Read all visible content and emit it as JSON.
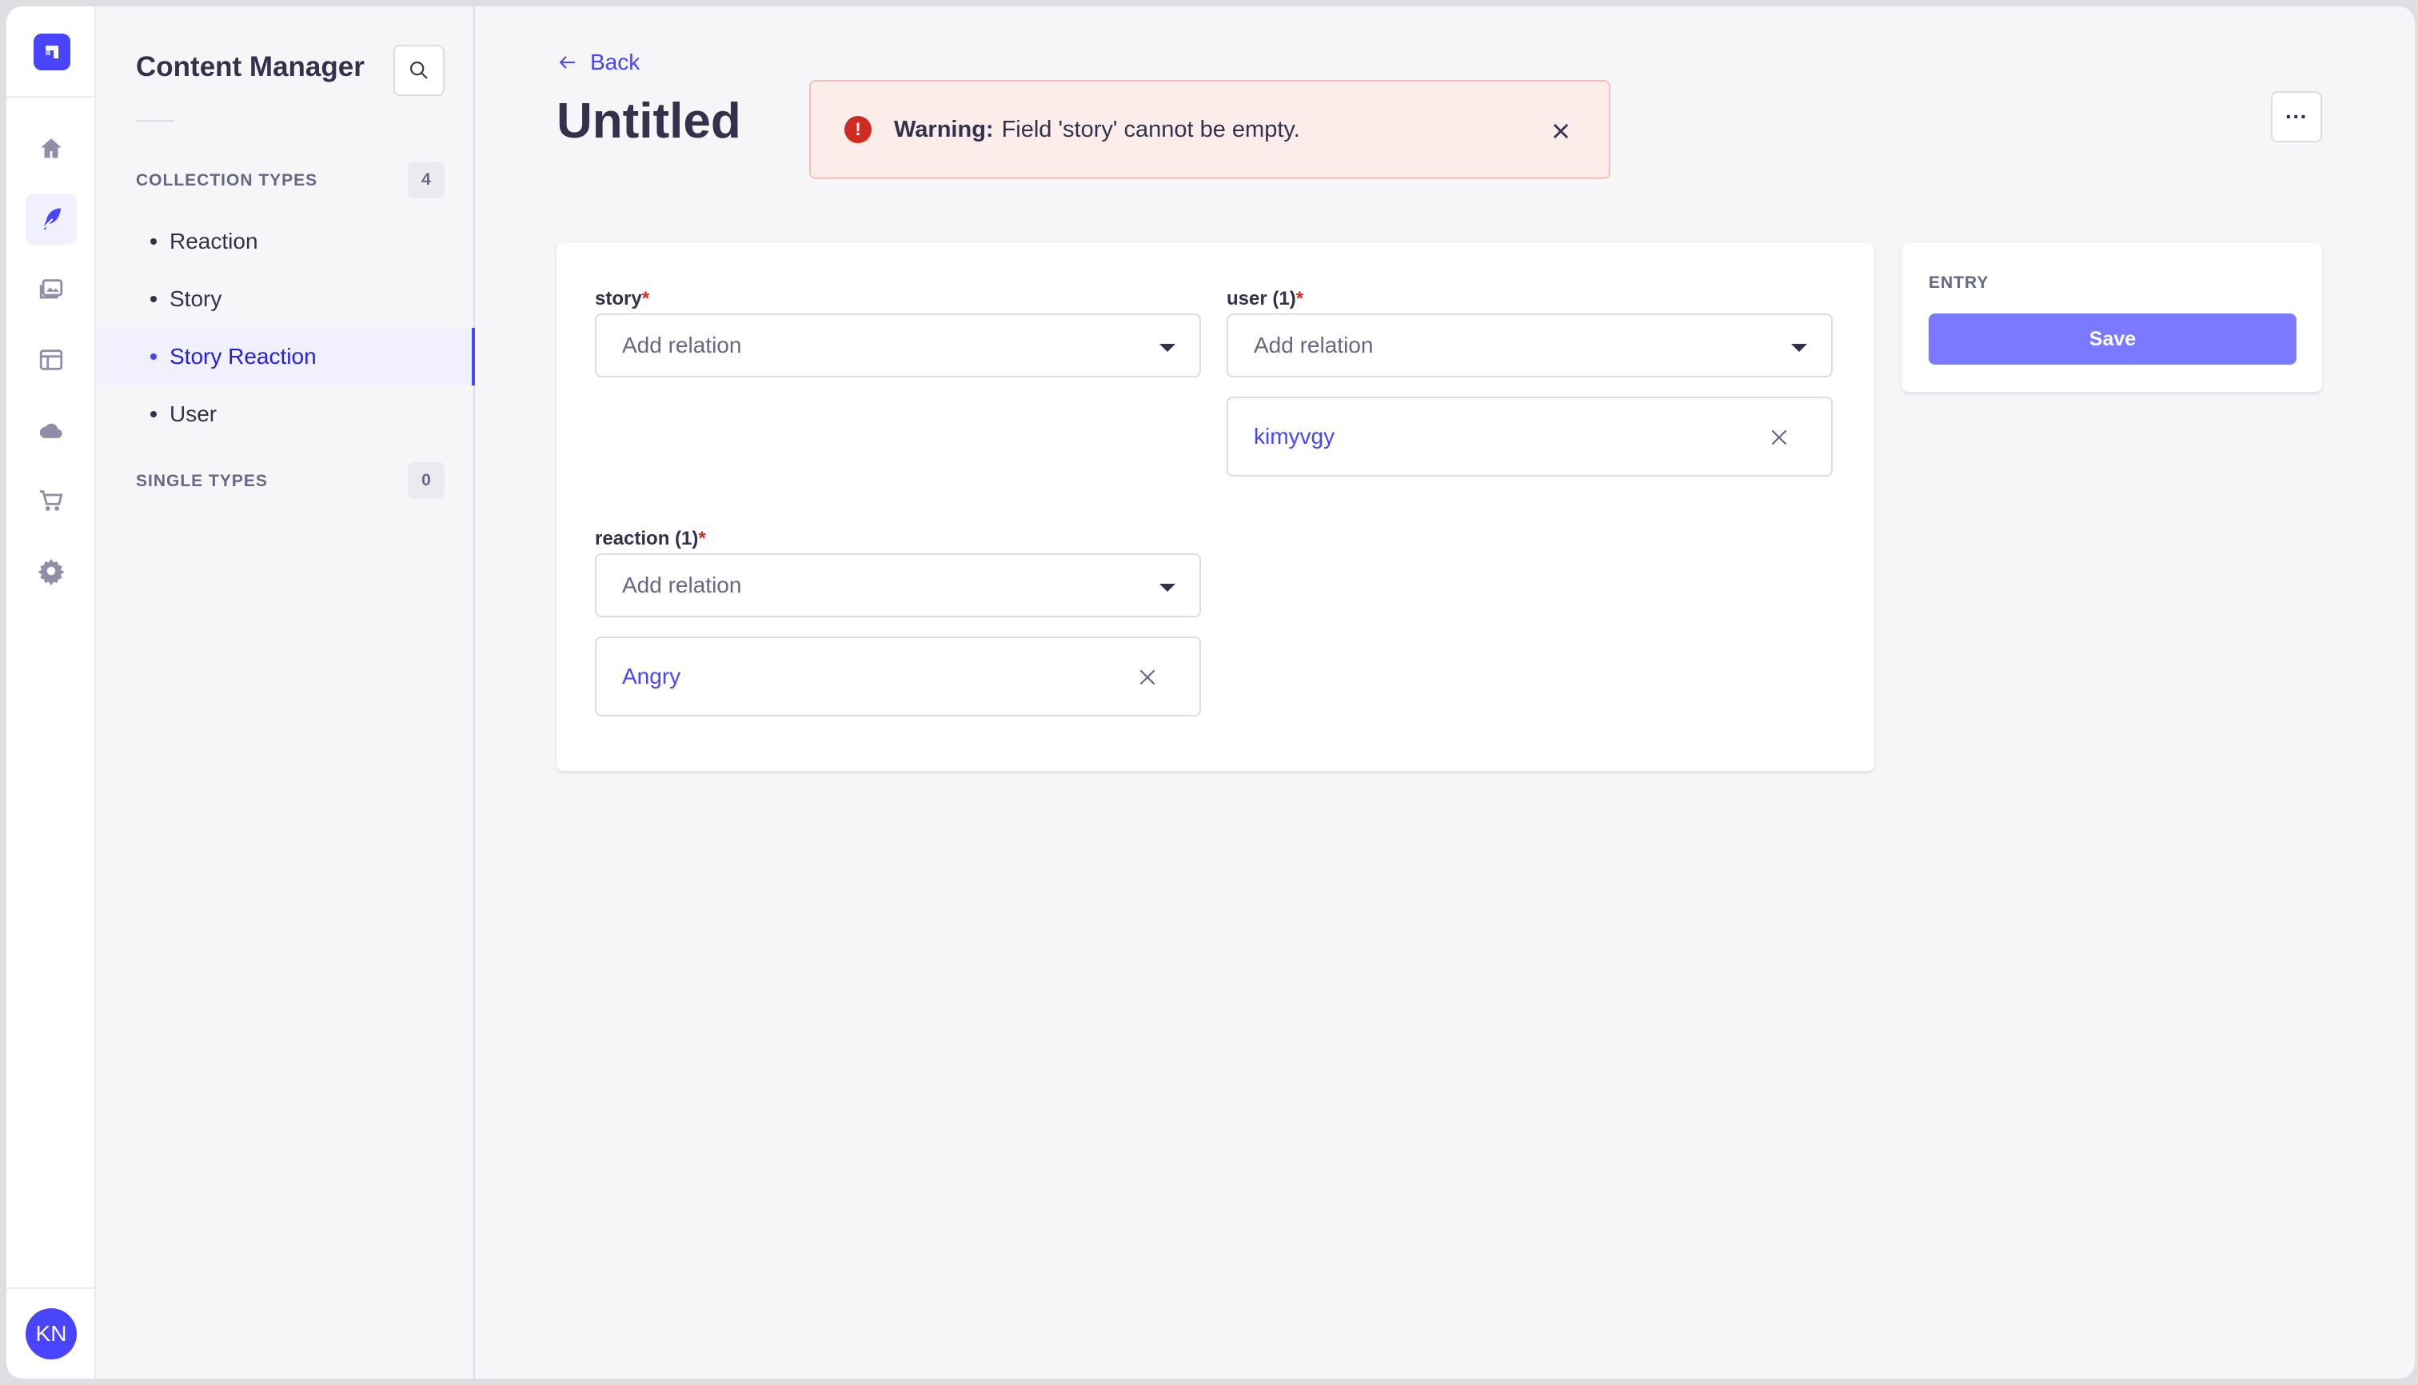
{
  "nav": {
    "items": [
      {
        "name": "home-icon"
      },
      {
        "name": "content-manager-icon"
      },
      {
        "name": "media-library-icon"
      },
      {
        "name": "content-type-builder-icon"
      },
      {
        "name": "cloud-icon"
      },
      {
        "name": "marketplace-icon"
      },
      {
        "name": "settings-icon"
      }
    ],
    "avatar_initials": "KN"
  },
  "subnav": {
    "title": "Content Manager",
    "collection_types_label": "COLLECTION TYPES",
    "collection_types_count": "4",
    "collection_items": [
      "Reaction",
      "Story",
      "Story Reaction",
      "User"
    ],
    "active_item": "Story Reaction",
    "single_types_label": "SINGLE TYPES",
    "single_types_count": "0"
  },
  "header": {
    "back_label": "Back",
    "title": "Untitled",
    "more_label": "···"
  },
  "alert": {
    "title": "Warning:",
    "message": "Field 'story' cannot be empty."
  },
  "form": {
    "story": {
      "label": "story",
      "placeholder": "Add relation"
    },
    "user": {
      "label": "user (1)",
      "placeholder": "Add relation",
      "selected": "kimyvgy"
    },
    "reaction": {
      "label": "reaction (1)",
      "placeholder": "Add relation",
      "selected": "Angry"
    },
    "required_mark": "*"
  },
  "entry_panel": {
    "label": "ENTRY",
    "save_label": "Save"
  },
  "colors": {
    "accent": "#4945ff",
    "danger": "#d02b20",
    "alert_bg": "#fcecea",
    "save_disabled": "#7b79ff"
  }
}
